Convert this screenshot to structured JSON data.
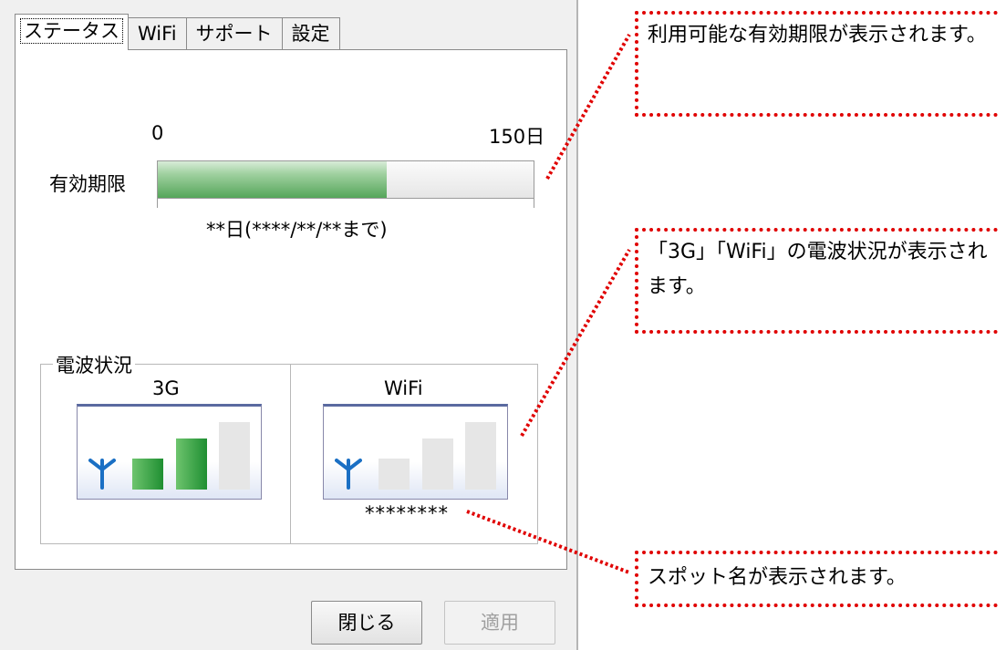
{
  "tabs": [
    "ステータス",
    "WiFi",
    "サポート",
    "設定"
  ],
  "expiry": {
    "label": "有効期限",
    "scale_min": "0",
    "scale_max": "150日",
    "remaining_text": "**日(****/**/**まで)",
    "fill_fraction": 0.61
  },
  "signal": {
    "group_title": "電波状況",
    "g3": {
      "label": "3G",
      "bars_on": 2,
      "bars_total": 3
    },
    "wifi": {
      "label": "WiFi",
      "bars_on": 0,
      "bars_total": 3,
      "spot_name": "********"
    }
  },
  "buttons": {
    "close": "閉じる",
    "apply": "適用"
  },
  "callouts": {
    "expiry": "利用可能な有効期限が表示されます。",
    "signal": "「3G」「WiFi」の電波状況が表示されます。",
    "spot": "スポット名が表示されます。"
  },
  "colors": {
    "annotation": "#e00000",
    "bar_on": "#2e9a3e",
    "antenna": "#1a6fc4"
  }
}
